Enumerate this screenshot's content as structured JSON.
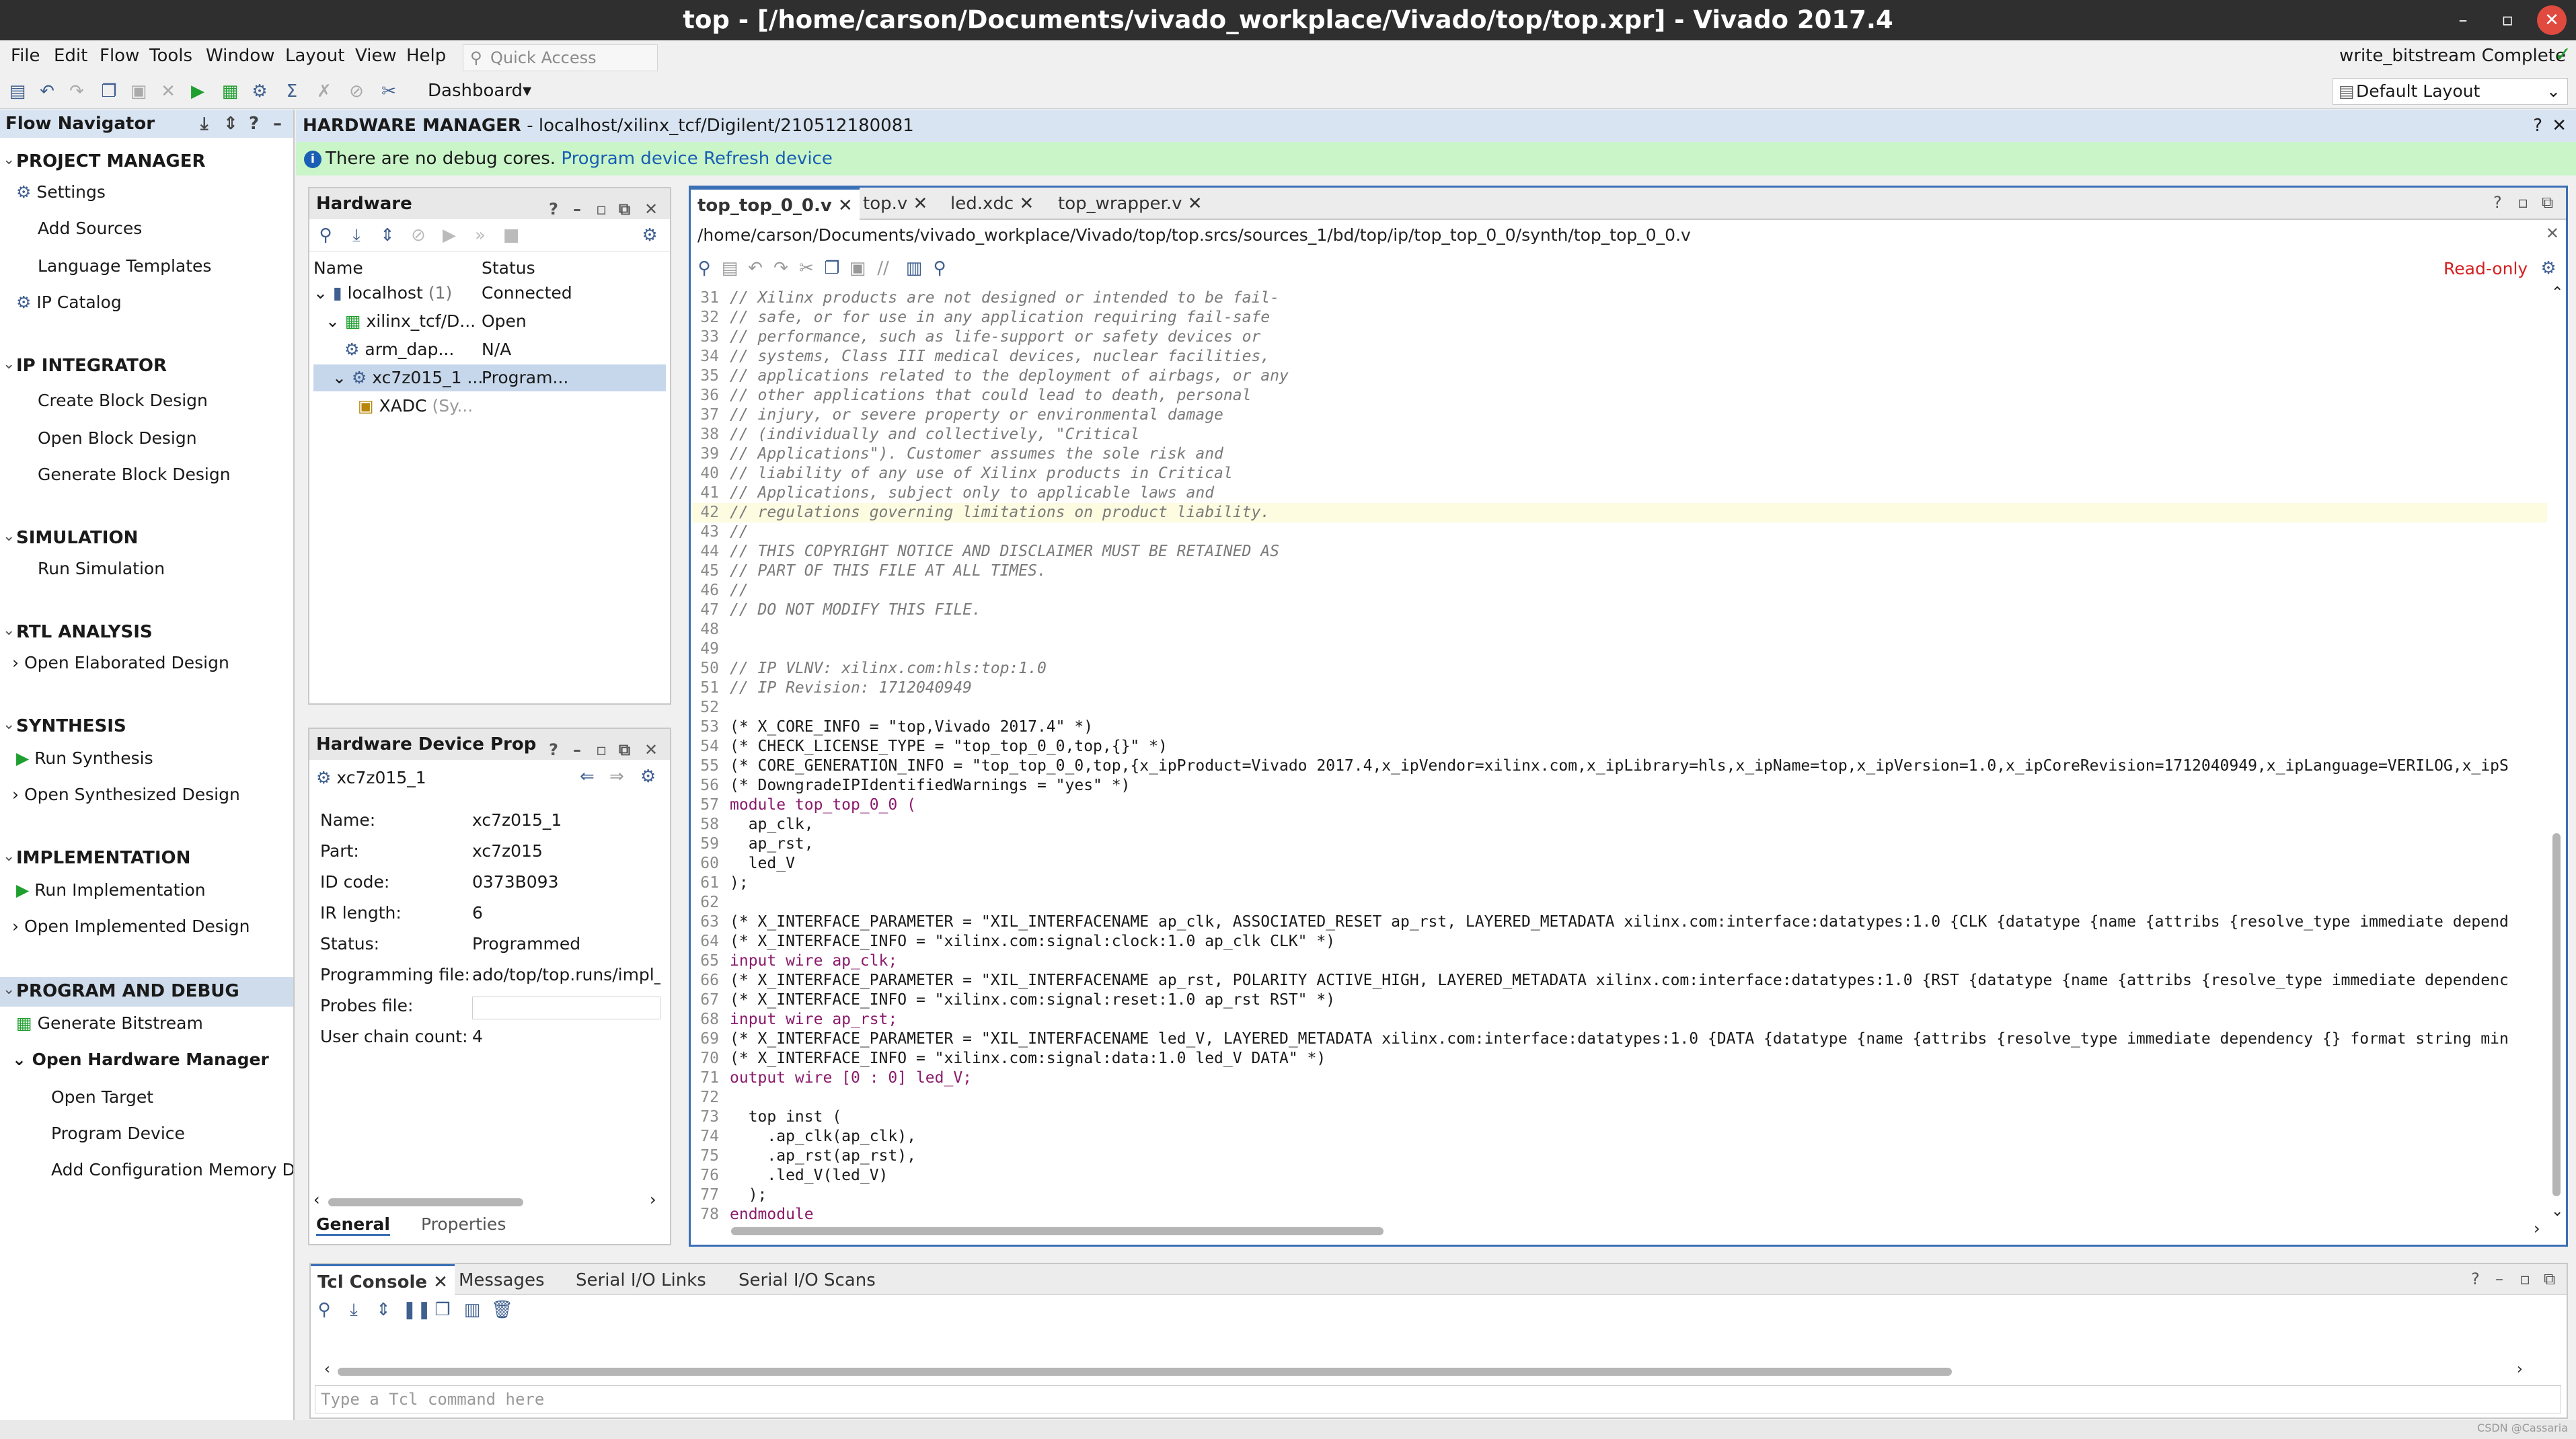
{
  "window": {
    "title": "top - [/home/carson/Documents/vivado_workplace/Vivado/top/top.xpr] - Vivado 2017.4"
  },
  "menu": [
    "File",
    "Edit",
    "Flow",
    "Tools",
    "Window",
    "Layout",
    "View",
    "Help"
  ],
  "quick_access": {
    "placeholder": "Quick Access"
  },
  "dashboard": "Dashboard",
  "status_right": "write_bitstream Complete",
  "layout_select": "Default Layout",
  "flow_navigator": {
    "title": "Flow Navigator",
    "sections": [
      {
        "label": "PROJECT MANAGER",
        "items": [
          "Settings",
          "Add Sources",
          "Language Templates",
          "IP Catalog"
        ]
      },
      {
        "label": "IP INTEGRATOR",
        "items": [
          "Create Block Design",
          "Open Block Design",
          "Generate Block Design"
        ]
      },
      {
        "label": "SIMULATION",
        "items": [
          "Run Simulation"
        ]
      },
      {
        "label": "RTL ANALYSIS",
        "items": [
          "Open Elaborated Design"
        ]
      },
      {
        "label": "SYNTHESIS",
        "items": [
          "Run Synthesis",
          "Open Synthesized Design"
        ]
      },
      {
        "label": "IMPLEMENTATION",
        "items": [
          "Run Implementation",
          "Open Implemented Design"
        ]
      },
      {
        "label": "PROGRAM AND DEBUG",
        "items": [
          "Generate Bitstream",
          "Open Hardware Manager",
          "Open Target",
          "Program Device",
          "Add Configuration Memory De"
        ]
      }
    ]
  },
  "hardware_manager": {
    "title": "HARDWARE MANAGER",
    "target": "localhost/xilinx_tcf/Digilent/210512180081",
    "info": "There are no debug cores.",
    "link_program": "Program device",
    "link_refresh": "Refresh device"
  },
  "hardware_panel": {
    "title": "Hardware",
    "columns": [
      "Name",
      "Status"
    ],
    "rows": [
      {
        "name": "localhost",
        "count": "(1)",
        "status": "Connected"
      },
      {
        "name": "xilinx_tcf/D...",
        "status": "Open"
      },
      {
        "name": "arm_dap...",
        "status": "N/A"
      },
      {
        "name": "xc7z015_1 ...",
        "status": "Program..."
      },
      {
        "name": "XADC",
        "note": "(Sy..."
      }
    ]
  },
  "device_props": {
    "title": "Hardware Device Prop",
    "device": "xc7z015_1",
    "props": [
      {
        "k": "Name:",
        "v": "xc7z015_1"
      },
      {
        "k": "Part:",
        "v": "xc7z015"
      },
      {
        "k": "ID code:",
        "v": "0373B093"
      },
      {
        "k": "IR length:",
        "v": "6"
      },
      {
        "k": "Status:",
        "v": "Programmed"
      },
      {
        "k": "Programming file:",
        "v": "ado/top/top.runs/impl_1/"
      },
      {
        "k": "Probes file:",
        "v": ""
      },
      {
        "k": "User chain count:",
        "v": "4"
      }
    ],
    "tabs": [
      "General",
      "Properties"
    ]
  },
  "editor": {
    "tabs": [
      "top_top_0_0.v",
      "top.v",
      "led.xdc",
      "top_wrapper.v"
    ],
    "path": "/home/carson/Documents/vivado_workplace/Vivado/top/top.srcs/sources_1/bd/top/ip/top_top_0_0/synth/top_top_0_0.v",
    "readonly": "Read-only",
    "lines": [
      {
        "n": "31",
        "t": "// Xilinx products are not designed or intended to be fail-"
      },
      {
        "n": "32",
        "t": "// safe, or for use in any application requiring fail-safe"
      },
      {
        "n": "33",
        "t": "// performance, such as life-support or safety devices or"
      },
      {
        "n": "34",
        "t": "// systems, Class III medical devices, nuclear facilities,"
      },
      {
        "n": "35",
        "t": "// applications related to the deployment of airbags, or any"
      },
      {
        "n": "36",
        "t": "// other applications that could lead to death, personal"
      },
      {
        "n": "37",
        "t": "// injury, or severe property or environmental damage"
      },
      {
        "n": "38",
        "t": "// (individually and collectively, \"Critical"
      },
      {
        "n": "39",
        "t": "// Applications\"). Customer assumes the sole risk and"
      },
      {
        "n": "40",
        "t": "// liability of any use of Xilinx products in Critical"
      },
      {
        "n": "41",
        "t": "// Applications, subject only to applicable laws and"
      },
      {
        "n": "42",
        "t": "// regulations governing limitations on product liability."
      },
      {
        "n": "43",
        "t": "//"
      },
      {
        "n": "44",
        "t": "// THIS COPYRIGHT NOTICE AND DISCLAIMER MUST BE RETAINED AS"
      },
      {
        "n": "45",
        "t": "// PART OF THIS FILE AT ALL TIMES."
      },
      {
        "n": "46",
        "t": "//"
      },
      {
        "n": "47",
        "t": "// DO NOT MODIFY THIS FILE."
      },
      {
        "n": "48",
        "t": ""
      },
      {
        "n": "49",
        "t": ""
      },
      {
        "n": "50",
        "t": "// IP VLNV: xilinx.com:hls:top:1.0"
      },
      {
        "n": "51",
        "t": "// IP Revision: 1712040949"
      },
      {
        "n": "52",
        "t": ""
      },
      {
        "n": "53",
        "t": "(* X_CORE_INFO = \"top,Vivado 2017.4\" *)"
      },
      {
        "n": "54",
        "t": "(* CHECK_LICENSE_TYPE = \"top_top_0_0,top,{}\" *)"
      },
      {
        "n": "55",
        "t": "(* CORE_GENERATION_INFO = \"top_top_0_0,top,{x_ipProduct=Vivado 2017.4,x_ipVendor=xilinx.com,x_ipLibrary=hls,x_ipName=top,x_ipVersion=1.0,x_ipCoreRevision=1712040949,x_ipLanguage=VERILOG,x_ipS"
      },
      {
        "n": "56",
        "t": "(* DowngradeIPIdentifiedWarnings = \"yes\" *)"
      },
      {
        "n": "57",
        "t": "module top_top_0_0 ("
      },
      {
        "n": "58",
        "t": "  ap_clk,"
      },
      {
        "n": "59",
        "t": "  ap_rst,"
      },
      {
        "n": "60",
        "t": "  led_V"
      },
      {
        "n": "61",
        "t": ");"
      },
      {
        "n": "62",
        "t": ""
      },
      {
        "n": "63",
        "t": "(* X_INTERFACE_PARAMETER = \"XIL_INTERFACENAME ap_clk, ASSOCIATED_RESET ap_rst, LAYERED_METADATA xilinx.com:interface:datatypes:1.0 {CLK {datatype {name {attribs {resolve_type immediate depend"
      },
      {
        "n": "64",
        "t": "(* X_INTERFACE_INFO = \"xilinx.com:signal:clock:1.0 ap_clk CLK\" *)"
      },
      {
        "n": "65",
        "t": "input wire ap_clk;"
      },
      {
        "n": "66",
        "t": "(* X_INTERFACE_PARAMETER = \"XIL_INTERFACENAME ap_rst, POLARITY ACTIVE_HIGH, LAYERED_METADATA xilinx.com:interface:datatypes:1.0 {RST {datatype {name {attribs {resolve_type immediate dependenc"
      },
      {
        "n": "67",
        "t": "(* X_INTERFACE_INFO = \"xilinx.com:signal:reset:1.0 ap_rst RST\" *)"
      },
      {
        "n": "68",
        "t": "input wire ap_rst;"
      },
      {
        "n": "69",
        "t": "(* X_INTERFACE_PARAMETER = \"XIL_INTERFACENAME led_V, LAYERED_METADATA xilinx.com:interface:datatypes:1.0 {DATA {datatype {name {attribs {resolve_type immediate dependency {} format string min"
      },
      {
        "n": "70",
        "t": "(* X_INTERFACE_INFO = \"xilinx.com:signal:data:1.0 led_V DATA\" *)"
      },
      {
        "n": "71",
        "t": "output wire [0 : 0] led_V;"
      },
      {
        "n": "72",
        "t": ""
      },
      {
        "n": "73",
        "t": "  top inst ("
      },
      {
        "n": "74",
        "t": "    .ap_clk(ap_clk),"
      },
      {
        "n": "75",
        "t": "    .ap_rst(ap_rst),"
      },
      {
        "n": "76",
        "t": "    .led_V(led_V)"
      },
      {
        "n": "77",
        "t": "  );"
      },
      {
        "n": "78",
        "t": "endmodule"
      }
    ]
  },
  "console": {
    "tabs": [
      "Tcl Console",
      "Messages",
      "Serial I/O Links",
      "Serial I/O Scans"
    ],
    "placeholder": "Type a Tcl command here"
  },
  "watermark": "CSDN @Cassaria"
}
